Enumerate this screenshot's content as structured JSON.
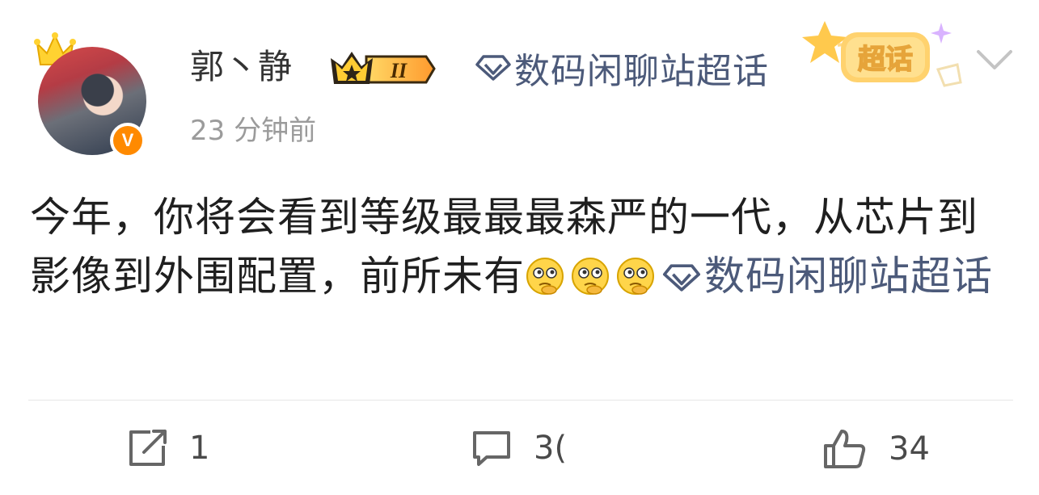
{
  "post": {
    "username": "郭丶静",
    "rank_badge": "II",
    "topic_label": "数码闲聊站超话",
    "supertopic_tag": "超话",
    "time": "23 分钟前",
    "content_text": "今年，你将会看到等级最最最森严的一代，从芯片到影像到外围配置，前所未有",
    "emoji_count": 3,
    "content_topic": "数码闲聊站超话",
    "avatar_badge": "V"
  },
  "actions": {
    "share_count": "1",
    "comment_count": "3(",
    "like_count": "34"
  },
  "colors": {
    "topic_blue": "#4c5a7a",
    "badge_orange": "#ff8a00",
    "muted_gray": "#9b9b9b"
  },
  "icons": [
    "crown-icon",
    "rank-crown-icon",
    "diamond-icon",
    "chevron-down-icon",
    "share-icon",
    "comment-icon",
    "like-icon",
    "thinking-emoji-icon"
  ]
}
